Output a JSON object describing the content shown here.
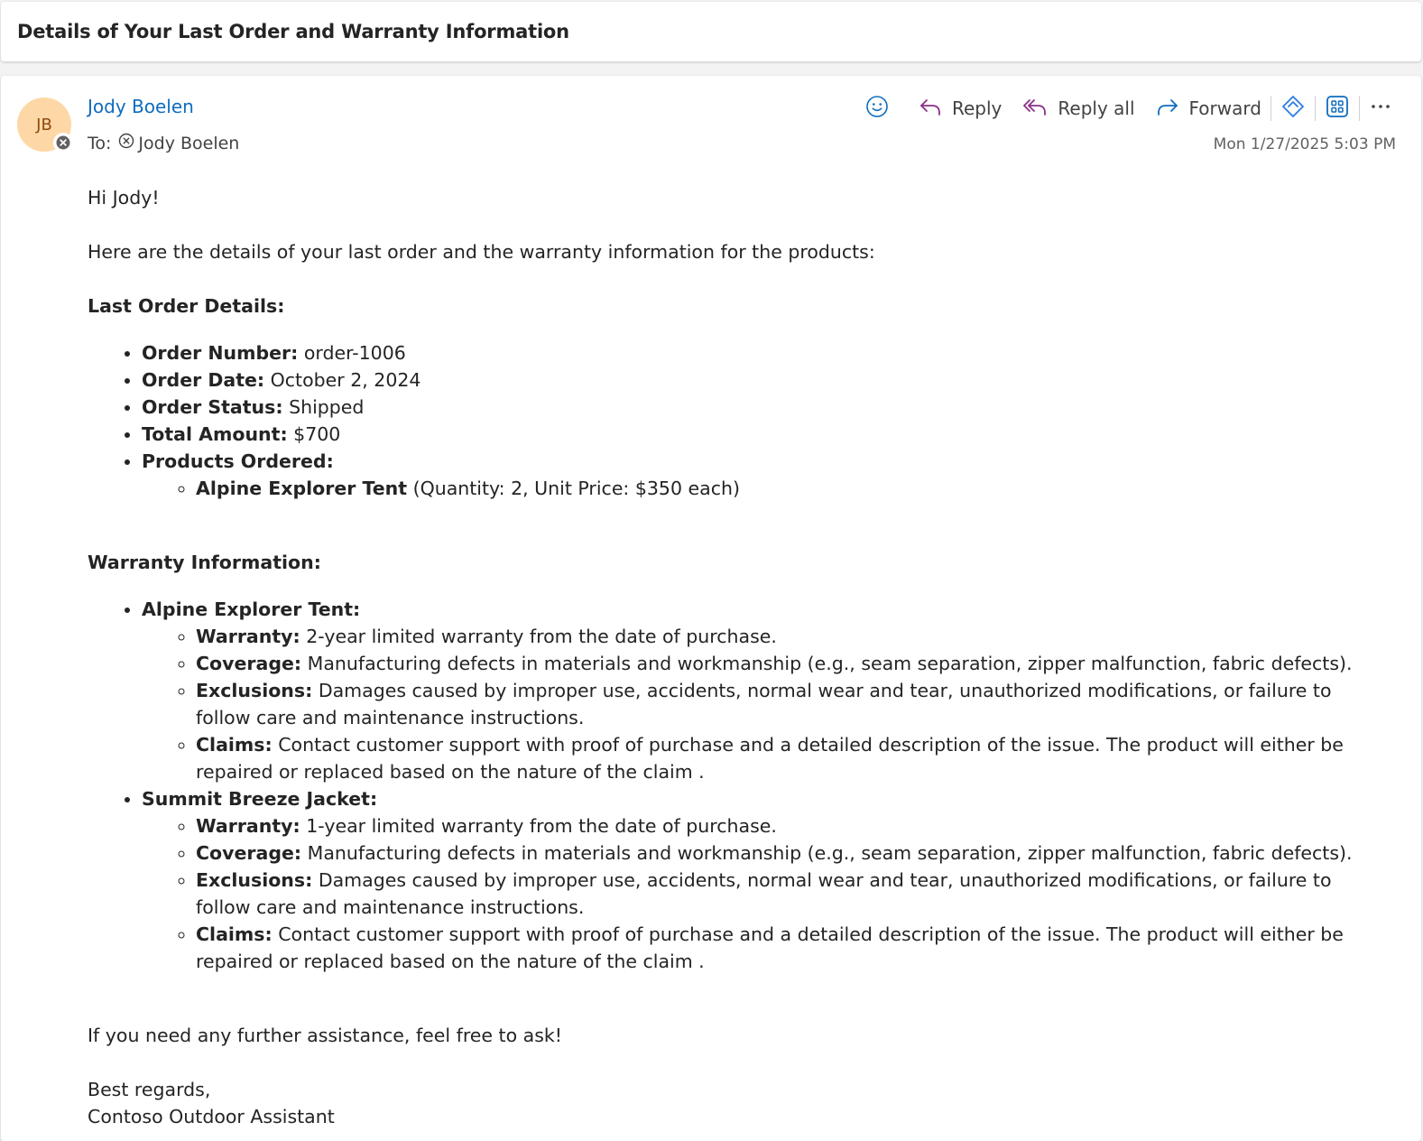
{
  "subject": "Details of Your Last Order and Warranty Information",
  "sender": {
    "initials": "JB",
    "name": "Jody Boelen"
  },
  "recipients": {
    "label": "To:",
    "name": "Jody Boelen"
  },
  "toolbar": {
    "reply": "Reply",
    "reply_all": "Reply all",
    "forward": "Forward"
  },
  "timestamp": "Mon 1/27/2025 5:03 PM",
  "colors": {
    "accent": "#0f6cbd",
    "reply_icon": "#8a2f8a",
    "forward_icon": "#0f6cbd",
    "avatar_bg": "#fdd8a6"
  },
  "icons": [
    "emoji-icon",
    "reply-icon",
    "reply-all-icon",
    "forward-icon",
    "loop-icon",
    "apps-icon",
    "more-icon",
    "blocked-icon"
  ],
  "body": {
    "greeting": "Hi Jody!",
    "intro": "Here are the details of your last order and the warranty information for the products:",
    "order_heading": "Last Order Details:",
    "order_items": [
      {
        "label": "Order Number:",
        "value": " order-1006"
      },
      {
        "label": "Order Date:",
        "value": " October 2, 2024"
      },
      {
        "label": "Order Status:",
        "value": " Shipped"
      },
      {
        "label": "Total Amount:",
        "value": " $700"
      },
      {
        "label": "Products Ordered:",
        "value": ""
      }
    ],
    "products": [
      {
        "name": "Alpine Explorer Tent",
        "detail": " (Quantity: 2, Unit Price: $350 each)"
      }
    ],
    "warranty_heading": "Warranty Information:",
    "warranties": [
      {
        "product": "Alpine Explorer Tent:",
        "items": [
          {
            "label": "Warranty:",
            "value": " 2-year limited warranty from the date of purchase."
          },
          {
            "label": "Coverage:",
            "value": " Manufacturing defects in materials and workmanship (e.g., seam separation, zipper malfunction, fabric defects)."
          },
          {
            "label": "Exclusions:",
            "value": " Damages caused by improper use, accidents, normal wear and tear, unauthorized modifications, or failure to follow care and maintenance instructions."
          },
          {
            "label": "Claims:",
            "value": " Contact customer support with proof of purchase and a detailed description of the issue. The product will either be repaired or replaced based on the nature of the claim ."
          }
        ]
      },
      {
        "product": "Summit Breeze Jacket:",
        "items": [
          {
            "label": "Warranty:",
            "value": " 1-year limited warranty from the date of purchase."
          },
          {
            "label": "Coverage:",
            "value": " Manufacturing defects in materials and workmanship (e.g., seam separation, zipper malfunction, fabric defects)."
          },
          {
            "label": "Exclusions:",
            "value": " Damages caused by improper use, accidents, normal wear and tear, unauthorized modifications, or failure to follow care and maintenance instructions."
          },
          {
            "label": "Claims:",
            "value": " Contact customer support with proof of purchase and a detailed description of the issue. The product will either be repaired or replaced based on the nature of the claim ."
          }
        ]
      }
    ],
    "closing": "If you need any further assistance, feel free to ask!",
    "signoff": "Best regards,",
    "signature": "Contoso Outdoor Assistant"
  }
}
